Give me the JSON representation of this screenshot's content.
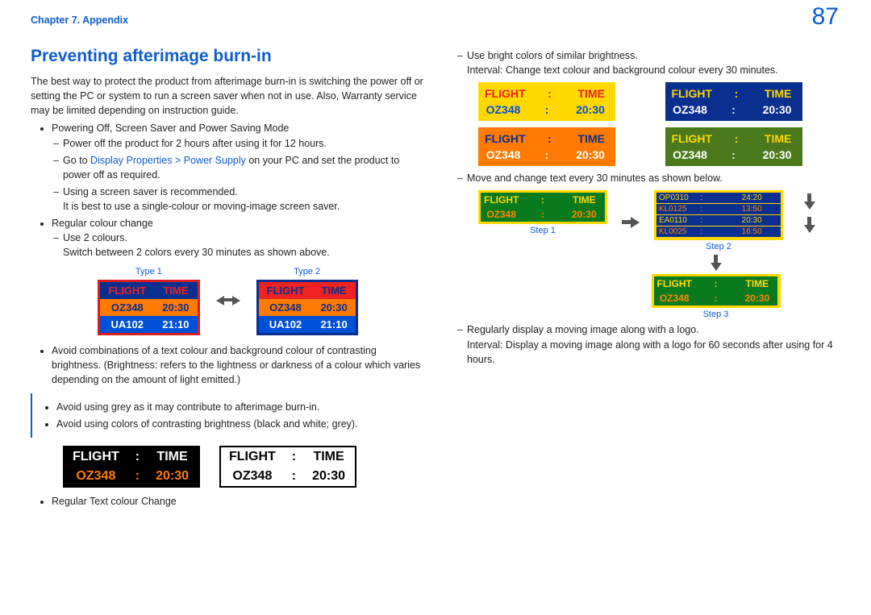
{
  "header": {
    "chapter": "Chapter 7. Appendix",
    "page": "87"
  },
  "left": {
    "title": "Preventing afterimage burn-in",
    "intro": "The best way to protect the product from afterimage burn-in is switching the power off or setting the PC or system to run a screen saver when not in use. Also, Warranty service may be limited depending on instruction guide.",
    "b1": "Powering Off, Screen Saver and Power Saving Mode",
    "b1a": "Power off the product for 2 hours after using it for 12 hours.",
    "b1b_pre": "Go to ",
    "b1b_link1": "Display Properties",
    "b1b_link2": "Power Supply",
    "b1b_post": " on your PC and set the product to power off as required.",
    "b1c": "Using a screen saver is recommended.",
    "b1c_sub": "It is best to use a single-colour or moving-image screen saver.",
    "b2": "Regular colour change",
    "b2a": "Use 2 colours.",
    "b2a_sub": "Switch between 2 colors every 30 minutes as shown above.",
    "type1_label": "Type 1",
    "type2_label": "Type 2",
    "avoid1": "Avoid combinations of a text colour and background colour of contrasting brightness. (Brightness: refers to the lightness or darkness of a colour which varies depending on the amount of light emitted.)",
    "callout1": "Avoid using grey as it may contribute to afterimage burn-in.",
    "callout2": "Avoid using colors of contrasting brightness (black and white; grey).",
    "b3": "Regular Text colour Change",
    "ft": {
      "h1": "FLIGHT",
      "h2": "TIME",
      "r1c1": "OZ348",
      "r1c2": "20:30",
      "r2c1": "UA102",
      "r2c2": "21:10"
    }
  },
  "right": {
    "r1": "Use bright colors of similar brightness.",
    "r1_sub": "Interval: Change text colour and background colour every 30 minutes.",
    "r2": "Move and change text every 30 minutes as shown below.",
    "step1": "Step 1",
    "step2": "Step 2",
    "step3": "Step 3",
    "s2": {
      "l1a": "OP0310",
      "l1b": "24:20",
      "l2a": "KL0125",
      "l2b": "13:50",
      "l3a": "EA0110",
      "l3b": "20:30",
      "l4a": "KL0025",
      "l4b": "16:50"
    },
    "r3": "Regularly display a moving image along with a logo.",
    "r3_sub": "Interval: Display a moving image along with a logo for 60 seconds after using for 4 hours."
  },
  "common": {
    "flight": "FLIGHT",
    "time": "TIME",
    "colon": ":",
    "oz": "OZ348",
    "t2030": "20:30"
  }
}
